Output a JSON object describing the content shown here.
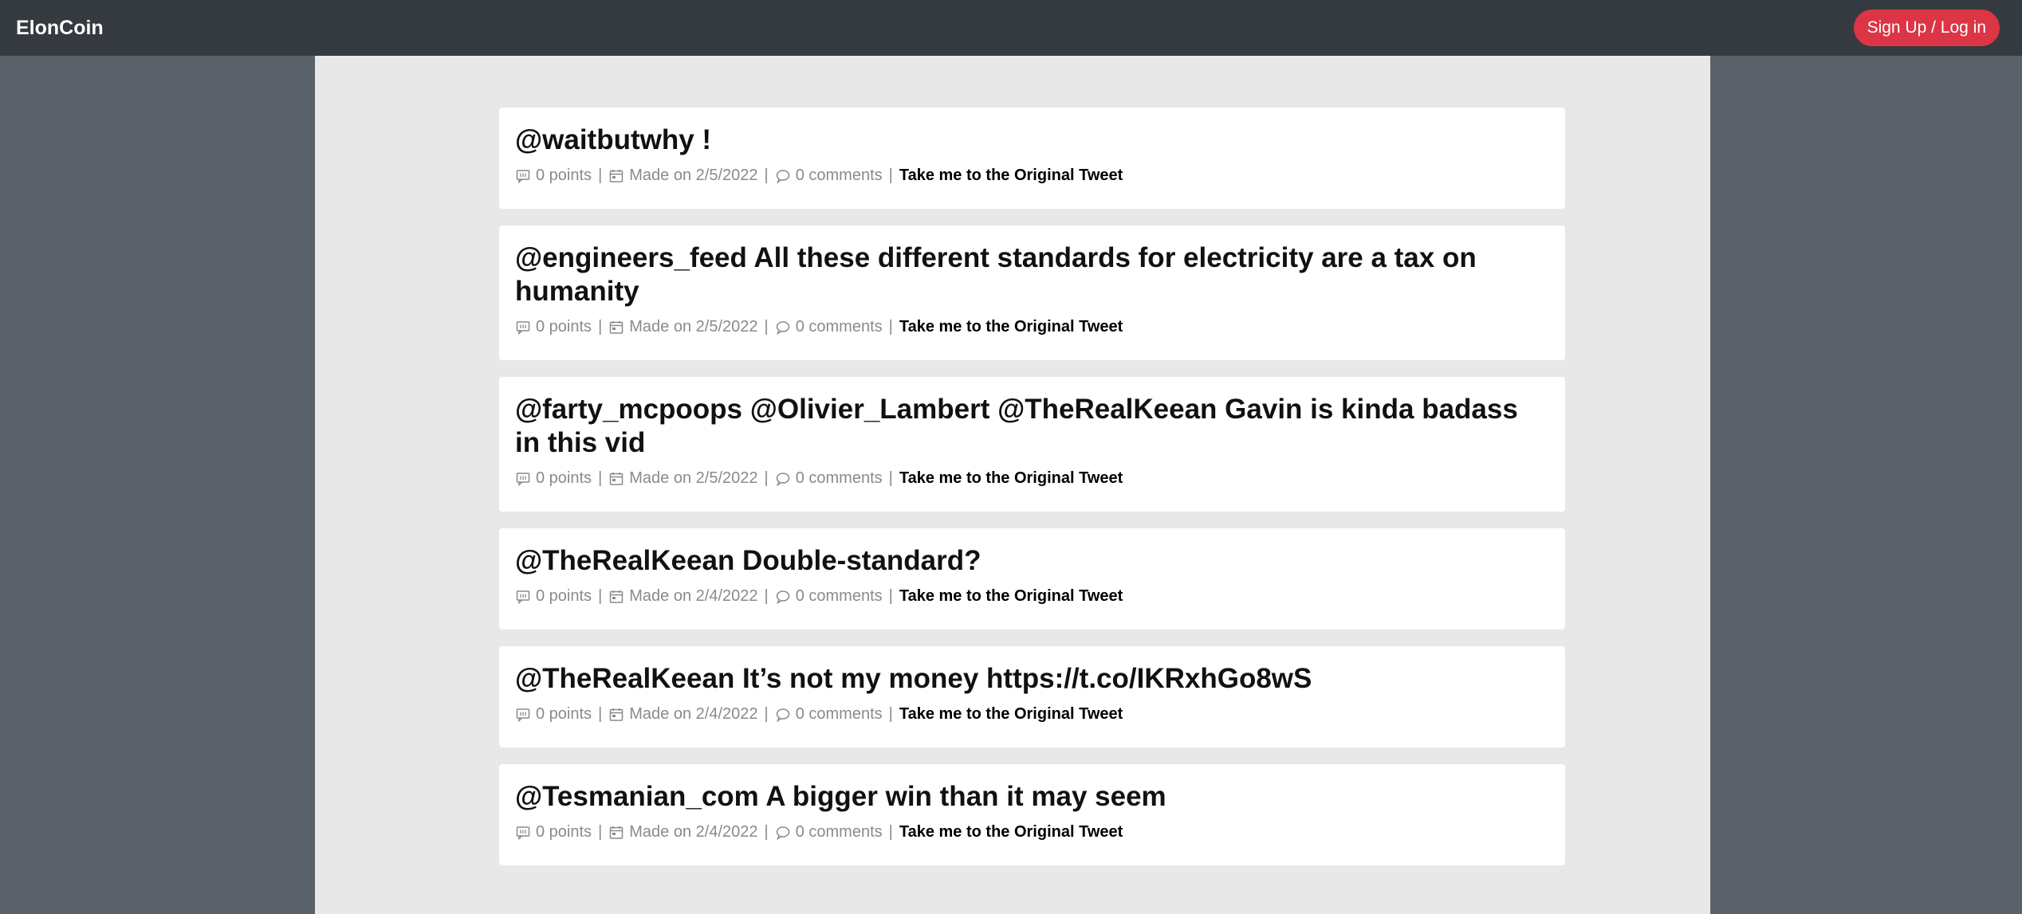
{
  "nav": {
    "brand": "ElonCoin",
    "login_label": "Sign Up / Log in"
  },
  "posts": [
    {
      "title": "@waitbutwhy !",
      "points": "0 points",
      "date": "Made on 2/5/2022",
      "comments": "0 comments",
      "link": "Take me to the Original Tweet"
    },
    {
      "title": "@engineers_feed All these different standards for electricity are a tax on humanity",
      "points": "0 points",
      "date": "Made on 2/5/2022",
      "comments": "0 comments",
      "link": "Take me to the Original Tweet"
    },
    {
      "title": "@farty_mcpoops @Olivier_Lambert @TheRealKeean Gavin is kinda badass in this vid",
      "points": "0 points",
      "date": "Made on 2/5/2022",
      "comments": "0 comments",
      "link": "Take me to the Original Tweet"
    },
    {
      "title": "@TheRealKeean Double-standard?",
      "points": "0 points",
      "date": "Made on 2/4/2022",
      "comments": "0 comments",
      "link": "Take me to the Original Tweet"
    },
    {
      "title": "@TheRealKeean It’s not my money https://t.co/IKRxhGo8wS",
      "points": "0 points",
      "date": "Made on 2/4/2022",
      "comments": "0 comments",
      "link": "Take me to the Original Tweet"
    },
    {
      "title": "@Tesmanian_com A bigger win than it may seem",
      "points": "0 points",
      "date": "Made on 2/4/2022",
      "comments": "0 comments",
      "link": "Take me to the Original Tweet"
    }
  ],
  "separator": "|",
  "icons": {
    "points": "chat-square-icon",
    "date": "calendar-icon",
    "comments": "speech-bubble-icon"
  },
  "colors": {
    "navbar": "#343a40",
    "accent": "#dc3545",
    "panel": "#e8e8e8",
    "background": "#5a6169"
  }
}
